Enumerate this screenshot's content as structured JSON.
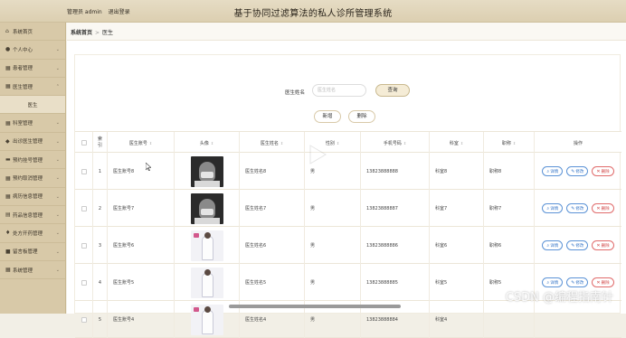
{
  "header": {
    "user_label": "管理员 admin",
    "logout_label": "退出登录",
    "app_title": "基于协同过滤算法的私人诊所管理系统"
  },
  "sidebar": {
    "items": [
      {
        "label": "系统首页",
        "icon": "home-icon"
      },
      {
        "label": "个人中心",
        "icon": "user-icon"
      },
      {
        "label": "患者管理",
        "icon": "grid-icon"
      },
      {
        "label": "医生管理",
        "icon": "grid-icon"
      },
      {
        "label": "医生",
        "sub": true
      },
      {
        "label": "科室管理",
        "icon": "grid-icon"
      },
      {
        "label": "出诊医生管理",
        "icon": "bookmark-icon"
      },
      {
        "label": "预约挂号管理",
        "icon": "card-icon"
      },
      {
        "label": "预约取消管理",
        "icon": "grid-icon"
      },
      {
        "label": "病历信息管理",
        "icon": "grid-icon"
      },
      {
        "label": "药品信息管理",
        "icon": "doc-icon"
      },
      {
        "label": "处方开药管理",
        "icon": "pin-icon"
      },
      {
        "label": "留言板管理",
        "icon": "lock-icon"
      },
      {
        "label": "系统管理",
        "icon": "grid-icon"
      }
    ]
  },
  "breadcrumb": {
    "home": "系统首页",
    "separator": ">",
    "current": "医生"
  },
  "search": {
    "label": "医生姓名",
    "placeholder": "医生姓名",
    "button": "查询"
  },
  "actions": {
    "add": "新增",
    "delete": "删除"
  },
  "table": {
    "columns": {
      "index": "索引",
      "doctor_no": "医生账号",
      "photo": "头像",
      "name": "医生姓名",
      "gender": "性别",
      "phone": "手机号码",
      "dept": "科室",
      "title": "职称",
      "ops": "操作"
    },
    "op_labels": {
      "detail": "详情",
      "edit": "修改",
      "delete": "删除"
    },
    "rows": [
      {
        "index": "1",
        "doctor_no": "医生账号8",
        "photo": "dark",
        "name": "医生姓名8",
        "gender": "男",
        "phone": "13823888888",
        "dept": "科室8",
        "title": "职称8"
      },
      {
        "index": "2",
        "doctor_no": "医生账号7",
        "photo": "dark",
        "name": "医生姓名7",
        "gender": "男",
        "phone": "13823888887",
        "dept": "科室7",
        "title": "职称7"
      },
      {
        "index": "3",
        "doctor_no": "医生账号6",
        "photo": "light",
        "name": "医生姓名6",
        "gender": "男",
        "phone": "13823888886",
        "dept": "科室6",
        "title": "职称6"
      },
      {
        "index": "4",
        "doctor_no": "医生账号5",
        "photo": "light",
        "name": "医生姓名5",
        "gender": "男",
        "phone": "13823888885",
        "dept": "科室5",
        "title": "职称5"
      },
      {
        "index": "5",
        "doctor_no": "医生账号4",
        "photo": "light",
        "name": "医生姓名4",
        "gender": "男",
        "phone": "13823888884",
        "dept": "科室4",
        "title": ""
      }
    ]
  },
  "watermark": "CSDN @编程指南针",
  "colors": {
    "sidebar_bg": "#d8c9a8",
    "header_bg": "#e6dcc4",
    "detail_blue": "#3877c8",
    "delete_red": "#d14545"
  }
}
